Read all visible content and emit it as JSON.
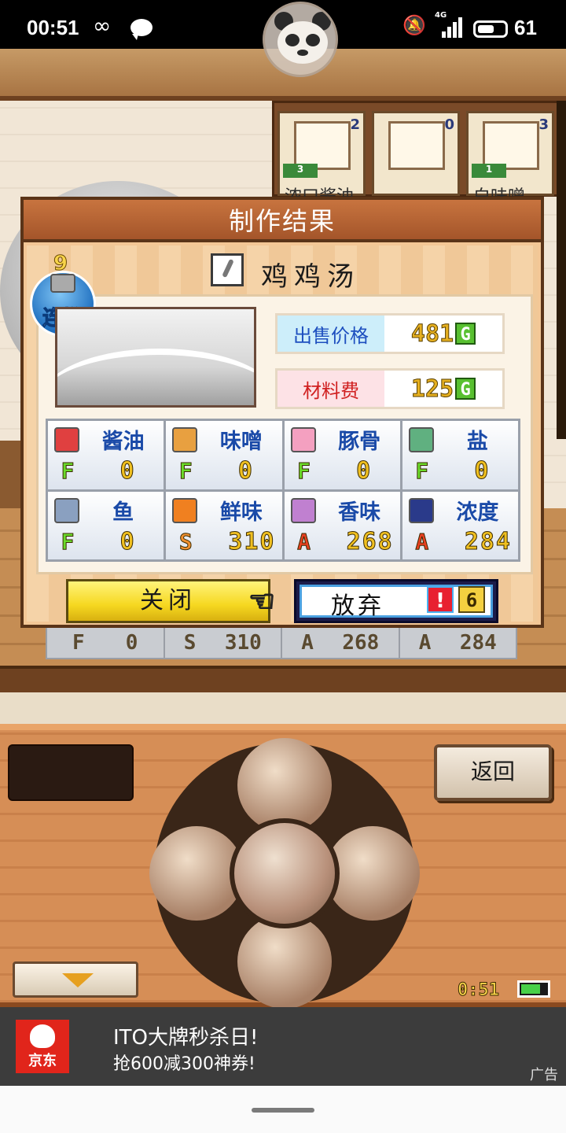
{
  "status_bar": {
    "time": "00:51",
    "network": "4G",
    "battery": "61",
    "battery_fraction": 0.61
  },
  "shelf": {
    "items": [
      {
        "name": "浓口酱油",
        "count": "2",
        "level": "3"
      },
      {
        "name": "",
        "count": "0",
        "level": ""
      },
      {
        "name": "白味噌",
        "count": "3",
        "level": "1"
      }
    ]
  },
  "dialog": {
    "title": "制作结果",
    "dish_name": "鸡鸡汤",
    "combo_badge": {
      "count": "9",
      "label": "连携"
    },
    "sell_price": {
      "label": "出售价格",
      "value": "481",
      "unit": "G"
    },
    "material_cost": {
      "label": "材料费",
      "value": "125",
      "unit": "G"
    },
    "stats": [
      {
        "name": "酱油",
        "rank": "F",
        "value": "0",
        "icon": "soy-sauce-icon"
      },
      {
        "name": "味噌",
        "rank": "F",
        "value": "0",
        "icon": "miso-icon"
      },
      {
        "name": "豚骨",
        "rank": "F",
        "value": "0",
        "icon": "pig-icon"
      },
      {
        "name": "盐",
        "rank": "F",
        "value": "0",
        "icon": "salt-icon"
      },
      {
        "name": "鱼",
        "rank": "F",
        "value": "0",
        "icon": "fish-icon"
      },
      {
        "name": "鲜味",
        "rank": "S",
        "value": "310",
        "icon": "umami-icon"
      },
      {
        "name": "香味",
        "rank": "A",
        "value": "268",
        "icon": "aroma-icon"
      },
      {
        "name": "浓度",
        "rank": "A",
        "value": "284",
        "icon": "thickness-icon"
      }
    ],
    "close_button": "关闭",
    "giveup_button": {
      "label": "放弃",
      "count": "6",
      "warn": "!"
    }
  },
  "background_row": [
    {
      "rank": "F",
      "value": "0"
    },
    {
      "rank": "S",
      "value": "310"
    },
    {
      "rank": "A",
      "value": "268"
    },
    {
      "rank": "A",
      "value": "284"
    }
  ],
  "controller": {
    "back_button": "返回",
    "clock": "0:51",
    "battery_fraction": 0.75
  },
  "ad": {
    "brand": "京东",
    "title": "ITO大牌秒杀日!",
    "subtitle": "抢600减300神券!",
    "tag": "广告"
  },
  "colors": {
    "dialog_bg": "#f3c796",
    "title_bar": "#a4552a",
    "sell_label_bg": "#cdeefa",
    "cost_label_bg": "#fde2e6",
    "rank_F": "#6adb2a",
    "rank_S": "#f09030",
    "rank_A": "#e84020",
    "close_button": "#f6d820"
  }
}
